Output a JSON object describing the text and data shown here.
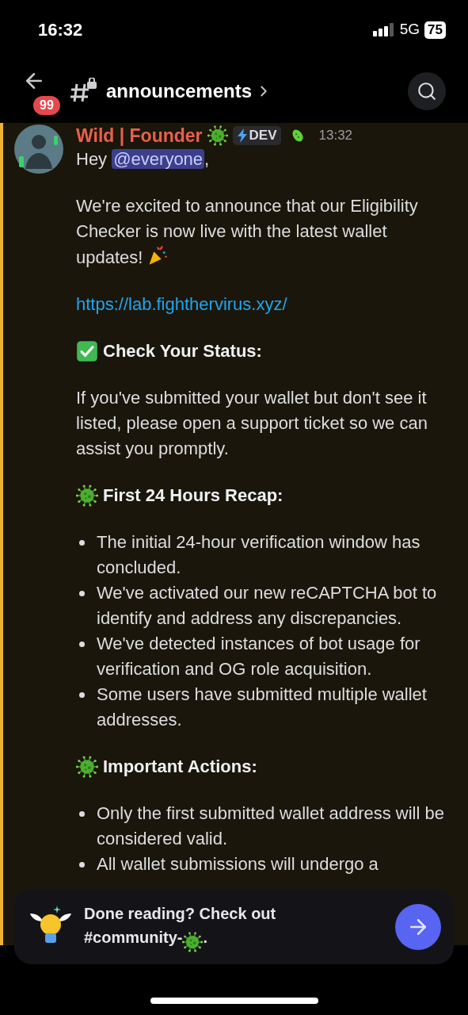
{
  "status_bar": {
    "time": "16:32",
    "network": "5G",
    "battery": "75"
  },
  "header": {
    "unread_badge": "99",
    "channel": "announcements"
  },
  "message": {
    "author": "Wild | Founder",
    "role_tag": "DEV",
    "timestamp": "13:32",
    "greeting": "Hey",
    "mention": "@everyone",
    "greeting_end": ",",
    "blocks": [
      {
        "kind": "announcement",
        "text": "We're excited to announce that our Eligibility Checker is now live with the latest wallet updates!"
      },
      {
        "kind": "link",
        "text": "https://lab.fighthervirus.xyz/"
      },
      {
        "kind": "status_heading",
        "text": "Check Your Status:"
      },
      {
        "kind": "paragraph",
        "text": "If you've submitted your wallet but don't see it listed, please open a support ticket so we can assist you promptly."
      },
      {
        "kind": "section_heading",
        "text": "First 24 Hours Recap:"
      },
      {
        "kind": "bullets",
        "items": [
          "The initial 24-hour verification window has concluded.",
          "We've activated our new reCAPTCHA bot to identify and address any discrepancies.",
          "We've detected instances of bot usage for verification and OG role acquisition.",
          "Some users have submitted multiple wallet addresses."
        ]
      },
      {
        "kind": "section_heading",
        "text": "Important Actions:"
      },
      {
        "kind": "bullets",
        "items": [
          "Only the first submitted wallet address will be considered valid.",
          "All wallet submissions will undergo a"
        ]
      }
    ]
  },
  "banner": {
    "text": "Done reading? Check out #community-",
    "text_end": "."
  }
}
